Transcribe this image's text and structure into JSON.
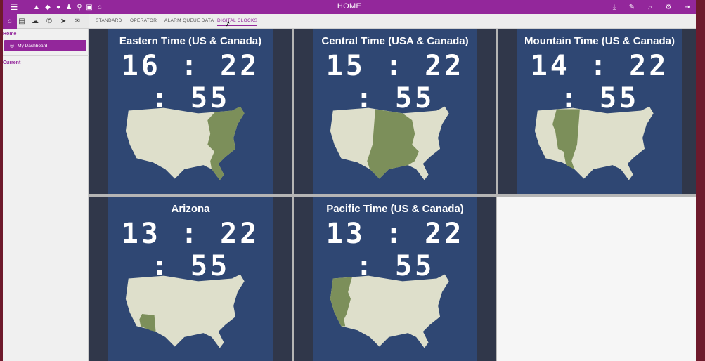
{
  "app": {
    "title": "HOME",
    "accent_color": "#93279b",
    "map_land_color": "#dedfcb",
    "map_highlight_color": "#7c8f5a",
    "tile_background": "#2f4773"
  },
  "topbar": {
    "left_icons": [
      "menu-icon",
      "warning-icon",
      "diamond-icon",
      "users-icon",
      "user-icon",
      "map-pin-icon",
      "bank-icon",
      "institution-icon"
    ],
    "right_icons": [
      "download-icon",
      "pencil-icon",
      "search-icon",
      "settings-icon",
      "logout-icon"
    ]
  },
  "toolbar_icons": [
    "home-icon",
    "document-icon",
    "chat-icon",
    "phone-icon",
    "send-icon",
    "mail-icon"
  ],
  "tabs": [
    {
      "label": "STANDARD"
    },
    {
      "label": "OPERATOR"
    },
    {
      "label": "ALARM QUEUE DATA"
    },
    {
      "label": "DIGITAL CLOCKS"
    }
  ],
  "active_tab": "DIGITAL CLOCKS",
  "sidebar": {
    "home_label": "Home",
    "dashboard_label": "My Dashboard",
    "current_label": "Current"
  },
  "clocks": [
    {
      "zone": "Eastern Time (US & Canada)",
      "time": "16 : 22 : 55",
      "highlight": "eastern"
    },
    {
      "zone": "Central Time (USA & Canada)",
      "time": "15 : 22 : 55",
      "highlight": "central"
    },
    {
      "zone": "Mountain Time (US & Canada)",
      "time": "14 : 22 : 55",
      "highlight": "mountain"
    },
    {
      "zone": "Arizona",
      "time": "13 : 22 : 55",
      "highlight": "arizona"
    },
    {
      "zone": "Pacific Time (US & Canada)",
      "time": "13 : 22 : 55",
      "highlight": "pacific"
    }
  ]
}
